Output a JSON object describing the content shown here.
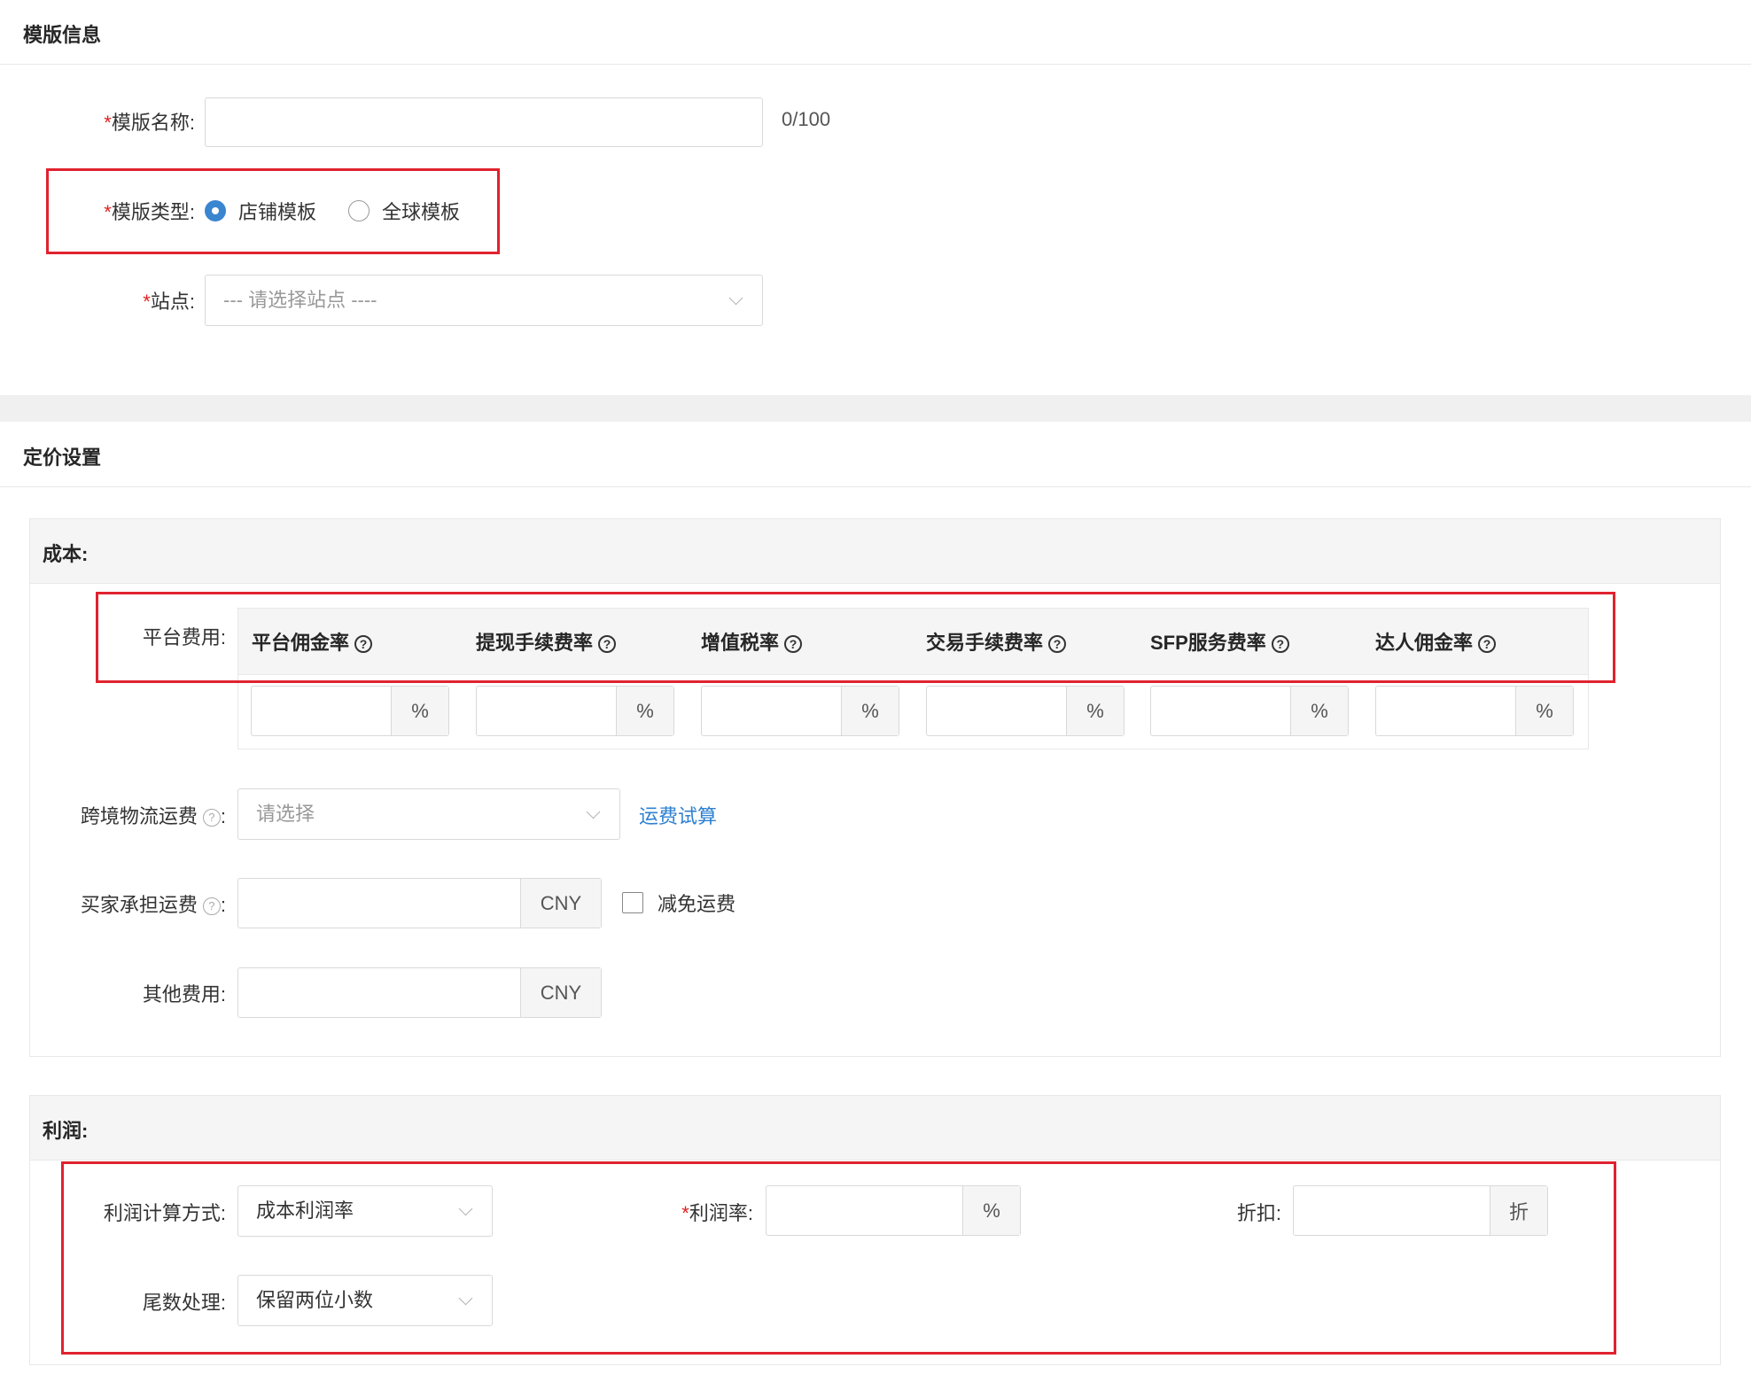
{
  "template_info": {
    "title": "模版信息",
    "name_label": "模版名称",
    "name_value": "",
    "name_counter": "0/100",
    "type_label": "模版类型",
    "type_options": [
      "店铺模板",
      "全球模板"
    ],
    "type_selected": "店铺模板",
    "site_label": "站点",
    "site_placeholder": "--- 请选择站点 ----"
  },
  "pricing": {
    "title": "定价设置",
    "cost": {
      "title": "成本:",
      "platform_fee_label": "平台费用",
      "fee_columns": [
        "平台佣金率",
        "提现手续费率",
        "增值税率",
        "交易手续费率",
        "SFP服务费率",
        "达人佣金率"
      ],
      "fee_unit": "%",
      "shipping_label": "跨境物流运费",
      "shipping_placeholder": "请选择",
      "shipping_link": "运费试算",
      "buyer_shipping_label": "买家承担运费",
      "buyer_shipping_unit": "CNY",
      "free_shipping_label": "减免运费",
      "free_shipping_checked": false,
      "other_fee_label": "其他费用",
      "other_fee_unit": "CNY"
    },
    "profit": {
      "title": "利润:",
      "method_label": "利润计算方式",
      "method_value": "成本利润率",
      "rate_label": "利润率",
      "rate_unit": "%",
      "discount_label": "折扣",
      "discount_unit": "折",
      "rounding_label": "尾数处理",
      "rounding_value": "保留两位小数"
    }
  },
  "colors": {
    "required": "#e02020",
    "highlight_box": "#e0222f",
    "link": "#2f80d0",
    "radio_selected": "#3a85d0"
  }
}
